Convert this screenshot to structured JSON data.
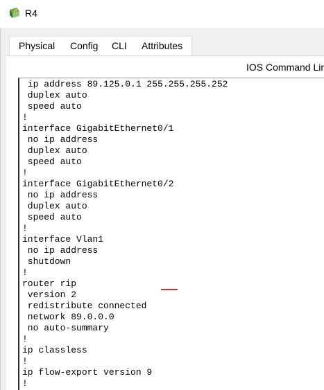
{
  "window": {
    "title": "R4"
  },
  "tabs": [
    {
      "label": "Physical"
    },
    {
      "label": "Config"
    },
    {
      "label": "CLI"
    },
    {
      "label": "Attributes"
    }
  ],
  "active_tab": "CLI",
  "panel": {
    "header": "IOS Command Line Interface"
  },
  "terminal": {
    "lines": [
      " ip address 89.125.0.1 255.255.255.252",
      " duplex auto",
      " speed auto",
      "!",
      "interface GigabitEthernet0/1",
      " no ip address",
      " duplex auto",
      " speed auto",
      "!",
      "interface GigabitEthernet0/2",
      " no ip address",
      " duplex auto",
      " speed auto",
      "!",
      "interface Vlan1",
      " no ip address",
      " shutdown",
      "!",
      "router rip",
      " version 2",
      " redistribute connected",
      " network 89.0.0.0",
      " no auto-summary",
      "!",
      "ip classless",
      "!",
      "ip flow-export version 9",
      "!"
    ]
  },
  "colors": {
    "annotation": "#d62b2b"
  },
  "icons": {
    "app": "packet-tracer-router-icon"
  }
}
